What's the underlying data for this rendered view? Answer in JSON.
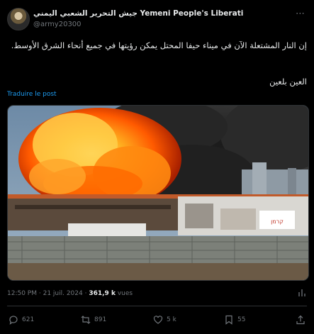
{
  "author": {
    "display_name": "جيش التحرير الشعبي اليمني Yemeni People's Liberati",
    "handle": "@army20300"
  },
  "tweet": {
    "text_line": "إن النار المشتعلة الآن في ميناء حيفا المحتل يمكن رؤيتها في جميع أنحاء الشرق الأوسط.",
    "text_second": "العين بلعين",
    "translate_label": "Traduire le post"
  },
  "meta": {
    "time": "12:50 PM",
    "date": "21 juil. 2024",
    "views_count": "361,9 k",
    "views_label": "vues"
  },
  "actions": {
    "replies": "621",
    "reposts": "891",
    "likes": "5 k",
    "bookmarks": "55"
  },
  "media": {
    "sign_text": "קרמן"
  },
  "colors": {
    "background": "#000000",
    "text": "#e7e9ea",
    "muted": "#71767b",
    "link": "#1d9bf0"
  }
}
